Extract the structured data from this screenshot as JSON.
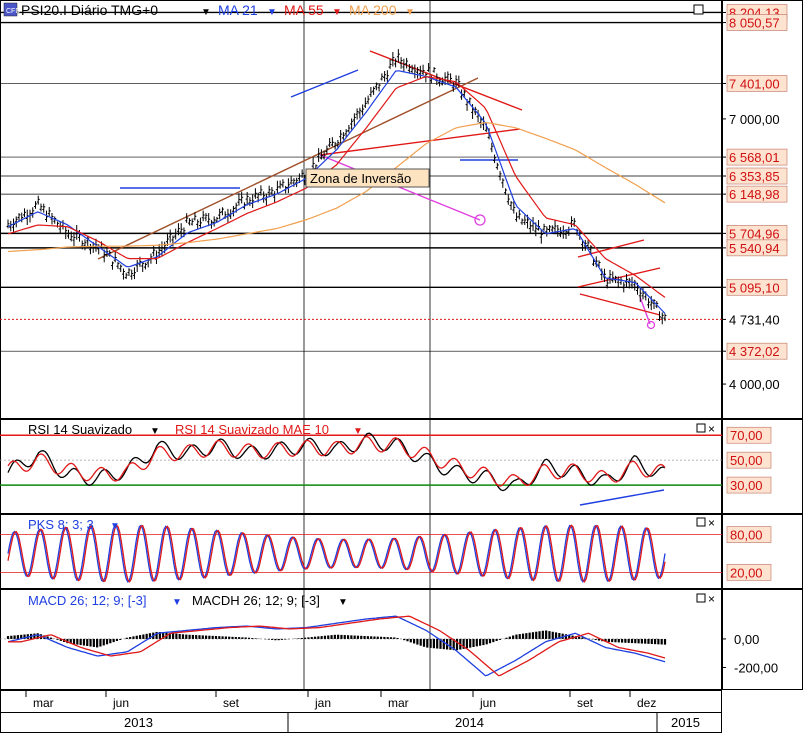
{
  "colors": {
    "background": "#ffffff",
    "price_bar": "#000000",
    "ma21": "#1f3fe0",
    "ma55": "#e01818",
    "ma200": "#f0a050",
    "rsi": "#000000",
    "rsi_signal": "#e01818",
    "stoch_k": "#1f3fe0",
    "stoch_d": "#e01818",
    "macd": "#1f3fe0",
    "macd_signal": "#e01818",
    "level_label_bg": "#fde3d0",
    "level_label_text": "#d01010",
    "annotation_box": "#fde3c0",
    "trend_magenta": "#e040e0"
  },
  "header": {
    "symbol": "PSI20.I Diário TMG+0",
    "ma21_label": "MA 21",
    "ma55_label": "MA 55",
    "ma200_label": "MA 200",
    "window_icon": "maximize-icon"
  },
  "price_axis": {
    "labels": [
      {
        "value": 8204.13,
        "text": "8 204,13",
        "boxed": true
      },
      {
        "value": 8090,
        "text": "8 050,57",
        "boxed": true
      },
      {
        "value": 7401.0,
        "text": "7 401,00",
        "boxed": true
      },
      {
        "value": 7000,
        "text": "7 000,00",
        "boxed": false
      },
      {
        "value": 6568.01,
        "text": "6 568,01",
        "boxed": true
      },
      {
        "value": 6353.85,
        "text": "6 353,85",
        "boxed": true
      },
      {
        "value": 6148.98,
        "text": "6 148,98",
        "boxed": true
      },
      {
        "value": 5704.96,
        "text": "5 704,96",
        "boxed": true
      },
      {
        "value": 5540.94,
        "text": "5 540,94",
        "boxed": true
      },
      {
        "value": 5095.1,
        "text": "5 095,10",
        "boxed": true
      },
      {
        "value": 4731.4,
        "text": "4 731,40",
        "boxed": false,
        "current": true
      },
      {
        "value": 4372.02,
        "text": "4 372,02",
        "boxed": true
      },
      {
        "value": 4000,
        "text": "4 000,00",
        "boxed": false
      }
    ]
  },
  "annotation": {
    "text": "Zona de  Inversão"
  },
  "rsi_panel": {
    "title": "RSI 14 Suavizado",
    "signal_label": "RSI 14 Suavizado MAE 10",
    "labels": [
      {
        "value": 70,
        "text": "70,00"
      },
      {
        "value": 50,
        "text": "50,00"
      },
      {
        "value": 30,
        "text": "30,00"
      }
    ]
  },
  "stoch_panel": {
    "title": "PKS 8; 3; 3",
    "labels": [
      {
        "value": 80,
        "text": "80,00"
      },
      {
        "value": 20,
        "text": "20,00"
      }
    ]
  },
  "macd_panel": {
    "title": "MACD 26; 12; 9; [-3]",
    "histogram_label": "MACDH 26; 12; 9; [-3]",
    "labels": [
      {
        "value": 0,
        "text": "0,00"
      },
      {
        "value": -200,
        "text": "-200,00"
      }
    ]
  },
  "time_axis": {
    "months": [
      "mar",
      "jun",
      "set",
      "jan",
      "mar",
      "jun",
      "set",
      "dez"
    ],
    "years": [
      "2013",
      "2014",
      "2015"
    ]
  },
  "chart_data": [
    {
      "type": "line",
      "panel": "price",
      "title": "PSI20.I Diário TMG+0",
      "x": [
        "2013-02",
        "2013-03",
        "2013-04",
        "2013-05",
        "2013-06",
        "2013-07",
        "2013-08",
        "2013-09",
        "2013-10",
        "2013-11",
        "2013-12",
        "2014-01",
        "2014-02",
        "2014-03",
        "2014-04",
        "2014-05",
        "2014-06",
        "2014-07",
        "2014-08",
        "2014-09",
        "2014-10",
        "2014-11",
        "2014-12"
      ],
      "series": [
        {
          "name": "PSI20.I",
          "values": [
            5800,
            6020,
            5700,
            5560,
            5250,
            5480,
            5810,
            5880,
            6080,
            6180,
            6380,
            6750,
            7180,
            7680,
            7530,
            7400,
            6880,
            5880,
            5700,
            5800,
            5180,
            5130,
            4730
          ]
        },
        {
          "name": "MA 21",
          "values": [
            5780,
            5950,
            5800,
            5560,
            5320,
            5440,
            5710,
            5830,
            6030,
            6150,
            6330,
            6650,
            7080,
            7550,
            7480,
            7360,
            6950,
            6020,
            5700,
            5760,
            5200,
            5150,
            4800
          ]
        },
        {
          "name": "MA 55",
          "values": [
            5700,
            5800,
            5780,
            5620,
            5420,
            5420,
            5600,
            5760,
            5930,
            6060,
            6220,
            6480,
            6900,
            7350,
            7480,
            7420,
            7120,
            6350,
            5880,
            5800,
            5420,
            5230,
            4980
          ]
        },
        {
          "name": "MA 200",
          "values": [
            5500,
            5520,
            5550,
            5560,
            5560,
            5570,
            5600,
            5640,
            5700,
            5760,
            5860,
            5990,
            6180,
            6450,
            6720,
            6900,
            6960,
            6900,
            6780,
            6650,
            6450,
            6260,
            6050
          ]
        }
      ],
      "ylim": [
        3650,
        8300
      ]
    },
    {
      "type": "line",
      "panel": "rsi",
      "title": "RSI 14 Suavizado",
      "series": [
        {
          "name": "RSI 14 Suavizado",
          "values": [
            40,
            55,
            38,
            35,
            42,
            60,
            55,
            62,
            55,
            58,
            62,
            58,
            66,
            62,
            50,
            40,
            36,
            28,
            45,
            40,
            32,
            48,
            38
          ]
        },
        {
          "name": "RSI 14 Suavizado MAE 10",
          "values": [
            42,
            50,
            42,
            38,
            40,
            55,
            56,
            60,
            57,
            58,
            60,
            59,
            63,
            62,
            54,
            45,
            38,
            32,
            41,
            41,
            35,
            44,
            40
          ]
        }
      ],
      "ylim": [
        10,
        75
      ]
    },
    {
      "type": "line",
      "panel": "stochastic",
      "title": "PKS 8; 3; 3",
      "series": [
        {
          "name": "PKS 8; 3; 3",
          "values": [
            20,
            85,
            15,
            80,
            10,
            90,
            20,
            85,
            15,
            90,
            25,
            80,
            20,
            95,
            15,
            85,
            10,
            90,
            20,
            80,
            15,
            85,
            10
          ]
        }
      ],
      "ylim": [
        0,
        100
      ]
    },
    {
      "type": "line",
      "panel": "macd",
      "title": "MACD 26; 12; 9; [-3]",
      "series": [
        {
          "name": "MACD 26; 12; 9; [-3]",
          "values": [
            -20,
            30,
            -60,
            -120,
            -90,
            40,
            60,
            80,
            90,
            70,
            80,
            110,
            140,
            160,
            60,
            -80,
            -260,
            -150,
            -20,
            40,
            -60,
            -100,
            -160
          ]
        },
        {
          "name": "MACDH 26; 12; 9; [-3]",
          "values": [
            20,
            40,
            -30,
            -60,
            10,
            50,
            30,
            20,
            10,
            -10,
            10,
            30,
            20,
            10,
            -60,
            -80,
            -40,
            30,
            60,
            20,
            -20,
            -30,
            -40
          ]
        }
      ],
      "ylim": [
        -330,
        280
      ]
    }
  ]
}
